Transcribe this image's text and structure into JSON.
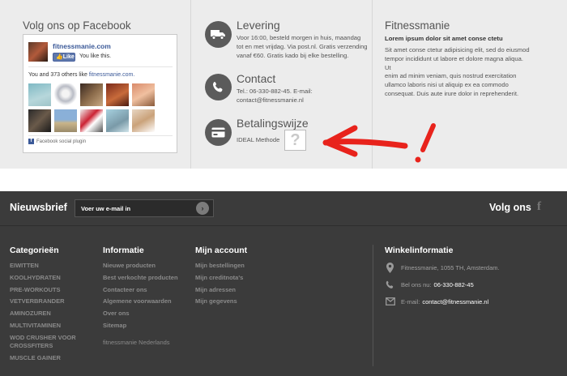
{
  "facebook": {
    "title": "Volg ons op Facebook",
    "page_name": "fitnessmanie.com",
    "like_label": "Like",
    "like_text": "You like this.",
    "others_prefix": "You and 373 others like ",
    "others_link": "fitnessmanie.com.",
    "plugin_label": "Facebook social plugin"
  },
  "services": [
    {
      "title": "Levering",
      "icon": "truck-icon",
      "text": [
        "Voor 16:00, besteld morgen in huis, maandag",
        "tot en met vrijdag. Via post.nl. Gratis verzending",
        "vanaf €60. Gratis kado bij elke bestelling."
      ]
    },
    {
      "title": "Contact",
      "icon": "phone-icon",
      "text": [
        "Tel.: 06-330-882-45. E-mail:",
        "contact@fitnessmanie.nl"
      ]
    },
    {
      "title": "Betalingswijze",
      "icon": "credit-card-icon",
      "text": [
        "IDEAL Methode"
      ],
      "placeholder_glyph": "?"
    }
  ],
  "fitnessmanie": {
    "title": "Fitnessmanie",
    "subtitle": "Lorem ipsum dolor sit amet conse ctetu",
    "text": [
      "Sit amet conse ctetur adipisicing elit, sed do eiusmod",
      "tempor incididunt ut labore et dolore magna aliqua. Ut",
      "enim ad minim veniam, quis nostrud exercitation",
      "ullamco laboris nisi ut aliquip ex ea commodo",
      "consequat. Duis aute irure dolor in reprehenderit."
    ]
  },
  "newsletter": {
    "label": "Nieuwsbrief",
    "placeholder": "Voer uw e-mail in",
    "button_glyph": "›"
  },
  "social": {
    "label": "Volg ons",
    "icon_glyph": "f"
  },
  "footer": {
    "categories": {
      "title": "Categorieën",
      "items": [
        "EIWITTEN",
        "KOOLHYDRATEN",
        "PRE-WORKOUTS",
        "VETVERBRANDER",
        "AMINOZUREN",
        "MULTIVITAMINEN",
        "WOD CRUSHER VOOR CROSSFITERS",
        "MUSCLE GAINER"
      ]
    },
    "informatie": {
      "title": "Informatie",
      "items": [
        "Nieuwe producten",
        "Best verkochte producten",
        "Contacteer ons",
        "Algemene voorwaarden",
        "Over ons",
        "Sitemap",
        "fitnessmanie Nederlands"
      ]
    },
    "account": {
      "title": "Mijn account",
      "items": [
        "Mijn bestellingen",
        "Mijn creditnota's",
        "Mijn adressen",
        "Mijn gegevens"
      ]
    },
    "winkel": {
      "title": "Winkelinformatie",
      "address": "Fitnessmanie, 1055 TH, Amsterdam.",
      "phone_label": "Bel ons nu:",
      "phone": "06-330-882-45",
      "email_label": "E-mail:",
      "email": "contact@fitnessmanie.nl"
    }
  },
  "colors": {
    "annotation": "#e8231c",
    "footer_bg": "#3b3b3b",
    "top_bg": "#ececec",
    "fb_blue": "#3b5998"
  }
}
